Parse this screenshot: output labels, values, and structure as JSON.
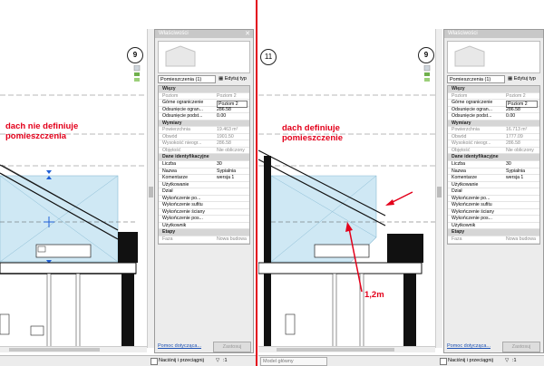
{
  "left_view": {
    "annotation": [
      "dach nie definiuje",
      "pomieszczenia"
    ],
    "view_tag": "9"
  },
  "right_view": {
    "annotation": [
      "dach definiuje",
      "pomieszczenie"
    ],
    "view_tag": "9",
    "level_tag": "11",
    "dimension_note": "1,2m"
  },
  "left_panel": {
    "title": "Właściwości",
    "type_select": "Pomieszczenia (1)",
    "edit_type": "Edytuj typ",
    "sections": [
      {
        "name": "Więzy",
        "rows": [
          {
            "k": "Poziom",
            "v": "Poziom 2",
            "gray": true
          },
          {
            "k": "Górne ograniczenie",
            "v": "Poziom 2",
            "box": true
          },
          {
            "k": "Odsunięcie ogran...",
            "v": "286.58"
          },
          {
            "k": "Odsunięcie podst...",
            "v": "0.00"
          }
        ]
      },
      {
        "name": "Wymiary",
        "rows": [
          {
            "k": "Powierzchnia",
            "v": "19.463 m²",
            "gray": true
          },
          {
            "k": "Obwód",
            "v": "1901.50",
            "gray": true
          },
          {
            "k": "Wysokość nieogr...",
            "v": "286.58",
            "gray": true
          },
          {
            "k": "Objętość",
            "v": "Nie obliczony",
            "gray": true
          }
        ]
      },
      {
        "name": "Dane identyfikacyjne",
        "rows": [
          {
            "k": "Liczba",
            "v": "30"
          },
          {
            "k": "Nazwa",
            "v": "Sypialnia"
          },
          {
            "k": "Komentarze",
            "v": "wersja 1"
          },
          {
            "k": "Użytkowanie",
            "v": ""
          },
          {
            "k": "Dział",
            "v": ""
          },
          {
            "k": "Wykończenie po...",
            "v": ""
          },
          {
            "k": "Wykończenie sufitu",
            "v": ""
          },
          {
            "k": "Wykończenie ściany",
            "v": ""
          },
          {
            "k": "Wykończenie pos...",
            "v": ""
          },
          {
            "k": "Użytkownik",
            "v": ""
          }
        ]
      },
      {
        "name": "Etapy",
        "rows": [
          {
            "k": "Faza",
            "v": "Nowa budowa",
            "gray": true
          }
        ]
      }
    ],
    "help_link": "Pomoc dotycząca...",
    "apply": "Zastosuj"
  },
  "right_panel": {
    "title": "Właściwości",
    "type_select": "Pomieszczenia (1)",
    "edit_type": "Edytuj typ",
    "sections": [
      {
        "name": "Więzy",
        "rows": [
          {
            "k": "Poziom",
            "v": "Poziom 2",
            "gray": true
          },
          {
            "k": "Górne ograniczenie",
            "v": "Poziom 2",
            "box": true
          },
          {
            "k": "Odsunięcie ogran...",
            "v": "286.58"
          },
          {
            "k": "Odsunięcie podst...",
            "v": "0.00"
          }
        ]
      },
      {
        "name": "Wymiary",
        "rows": [
          {
            "k": "Powierzchnia",
            "v": "16.713 m²",
            "gray": true
          },
          {
            "k": "Obwód",
            "v": "1777.09",
            "gray": true
          },
          {
            "k": "Wysokość nieogr...",
            "v": "286.58",
            "gray": true
          },
          {
            "k": "Objętość",
            "v": "Nie obliczony",
            "gray": true
          }
        ]
      },
      {
        "name": "Dane identyfikacyjne",
        "rows": [
          {
            "k": "Liczba",
            "v": "30"
          },
          {
            "k": "Nazwa",
            "v": "Sypialnia"
          },
          {
            "k": "Komentarze",
            "v": "wersja 1"
          },
          {
            "k": "Użytkowanie",
            "v": ""
          },
          {
            "k": "Dział",
            "v": ""
          },
          {
            "k": "Wykończenie po...",
            "v": ""
          },
          {
            "k": "Wykończenie sufitu",
            "v": ""
          },
          {
            "k": "Wykończenie ściany",
            "v": ""
          },
          {
            "k": "Wykończenie pos...",
            "v": ""
          },
          {
            "k": "Użytkownik",
            "v": ""
          }
        ]
      },
      {
        "name": "Etapy",
        "rows": [
          {
            "k": "Faza",
            "v": "Nowa budowa",
            "gray": true
          }
        ]
      }
    ],
    "help_link": "Pomoc dotycząca...",
    "apply": "Zastosuj"
  },
  "status_bar": {
    "left_check_label": "Naciśnij i przeciągnij",
    "model": "Model główny",
    "right_check_label": "Naciśnij i przeciągnij",
    "filter_count": ":1"
  },
  "colors": {
    "room_fill": "#cfe8f4",
    "annotation": "#e3001b",
    "divider": "#e3001b"
  }
}
